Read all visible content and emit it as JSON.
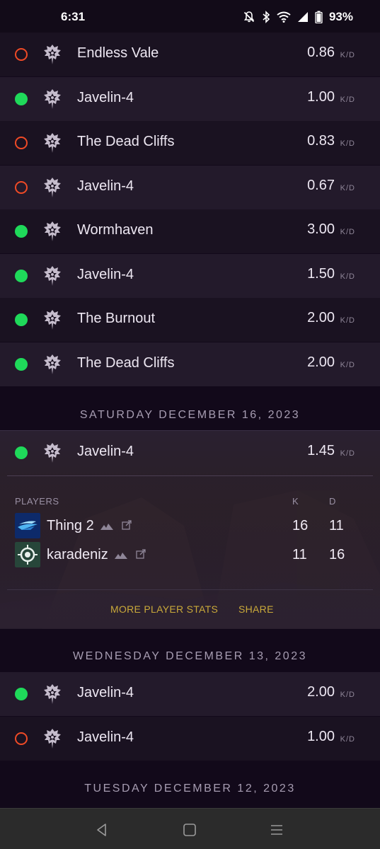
{
  "status_bar": {
    "time": "6:31",
    "battery": "93%",
    "icons": [
      "mute-icon",
      "bluetooth-icon",
      "wifi-icon",
      "signal-icon",
      "battery-icon"
    ]
  },
  "kd_unit": "K/D",
  "colors": {
    "win": "#1fd95a",
    "loss": "#ef4a26",
    "accent": "#c9a93a",
    "background": "#12091a"
  },
  "activities_top": [
    {
      "result": "loss",
      "map": "Endless Vale",
      "kd": "0.86"
    },
    {
      "result": "win",
      "map": "Javelin-4",
      "kd": "1.00"
    },
    {
      "result": "loss",
      "map": "The Dead Cliffs",
      "kd": "0.83"
    },
    {
      "result": "loss",
      "map": "Javelin-4",
      "kd": "0.67"
    },
    {
      "result": "win",
      "map": "Wormhaven",
      "kd": "3.00"
    },
    {
      "result": "win",
      "map": "Javelin-4",
      "kd": "1.50"
    },
    {
      "result": "win",
      "map": "The Burnout",
      "kd": "2.00"
    },
    {
      "result": "win",
      "map": "The Dead Cliffs",
      "kd": "2.00"
    }
  ],
  "sections": [
    {
      "date": "SATURDAY DECEMBER 16, 2023"
    },
    {
      "date": "WEDNESDAY DECEMBER 13, 2023"
    },
    {
      "date": "TUESDAY DECEMBER 12, 2023"
    }
  ],
  "expanded_activity": {
    "result": "win",
    "map": "Javelin-4",
    "kd": "1.45",
    "players_label": "PLAYERS",
    "col_k": "K",
    "col_d": "D",
    "players": [
      {
        "name": "Thing 2",
        "kills": "16",
        "deaths": "11"
      },
      {
        "name": "karadeniz",
        "kills": "11",
        "deaths": "16"
      }
    ],
    "more_stats_label": "MORE PLAYER STATS",
    "share_label": "SHARE"
  },
  "activities_dec13": [
    {
      "result": "win",
      "map": "Javelin-4",
      "kd": "2.00"
    },
    {
      "result": "loss",
      "map": "Javelin-4",
      "kd": "1.00"
    }
  ],
  "nav": {
    "icons": [
      "back-icon",
      "home-icon",
      "recents-icon"
    ]
  }
}
